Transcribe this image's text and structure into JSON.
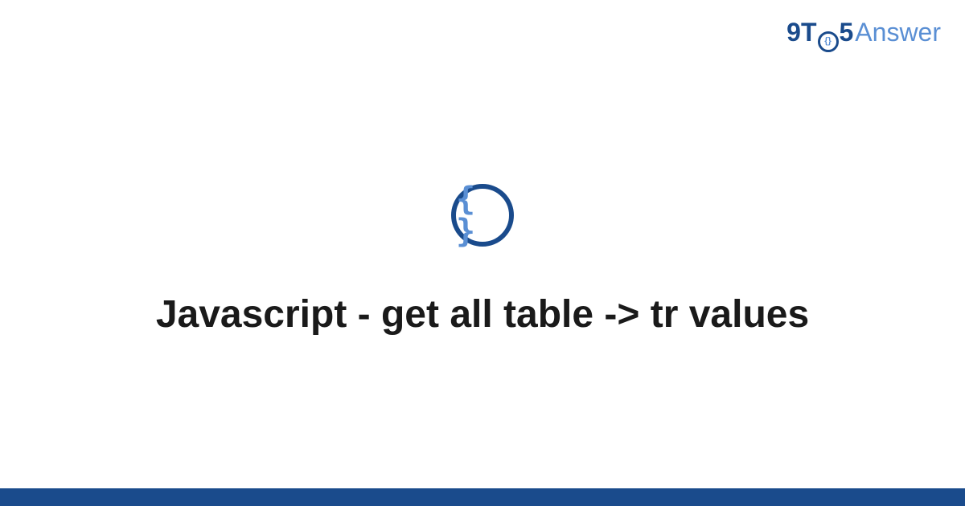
{
  "logo": {
    "part1": "9T",
    "part_o_inner": "{}",
    "part2": "5",
    "part3": "Answer"
  },
  "icon": {
    "glyph": "{ }",
    "name": "code-braces-icon"
  },
  "title": "Javascript - get all table -> tr values",
  "colors": {
    "primary_dark": "#1a4b8c",
    "primary_light": "#5a8fd4",
    "text": "#1a1a1a",
    "background": "#ffffff"
  }
}
